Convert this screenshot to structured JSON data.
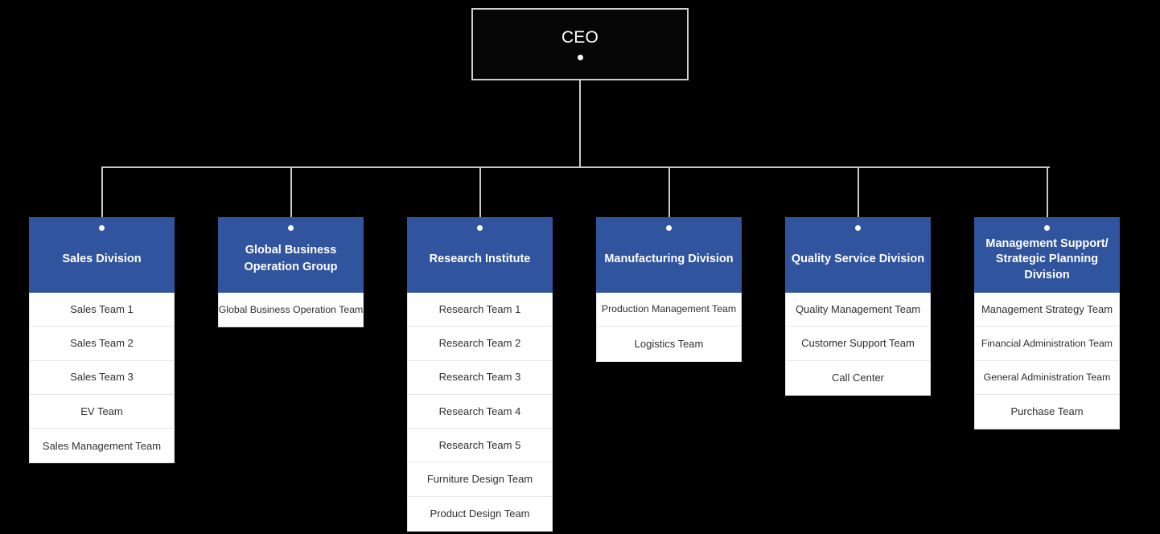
{
  "chart": {
    "type": "org-chart",
    "background_color": "#000000",
    "accent_color": "#31549f",
    "connector_color": "#c9c9c9",
    "root": {
      "label": "CEO",
      "text_color": "#ffffff",
      "fill_color": "#060606",
      "border_color": "#cfcfcf"
    },
    "divisions": [
      {
        "title": "Sales Division",
        "teams": [
          "Sales Team 1",
          "Sales Team 2",
          "Sales Team 3",
          "EV Team",
          "Sales Management Team"
        ]
      },
      {
        "title": "Global Business Operation Group",
        "teams": [
          "Global Business Operation Team"
        ]
      },
      {
        "title": "Research Institute",
        "teams": [
          "Research Team 1",
          "Research Team 2",
          "Research Team 3",
          "Research Team 4",
          "Research Team 5",
          "Furniture Design Team",
          "Product Design Team"
        ]
      },
      {
        "title": "Manufacturing Division",
        "teams": [
          "Production Management Team",
          "Logistics Team"
        ]
      },
      {
        "title": "Quality Service Division",
        "teams": [
          "Quality Management Team",
          "Customer Support Team",
          "Call Center"
        ]
      },
      {
        "title": "Management Support/ Strategic Planning Division",
        "teams": [
          "Management Strategy Team",
          "Financial Administration Team",
          "General Administration Team",
          "Purchase Team"
        ]
      }
    ]
  }
}
